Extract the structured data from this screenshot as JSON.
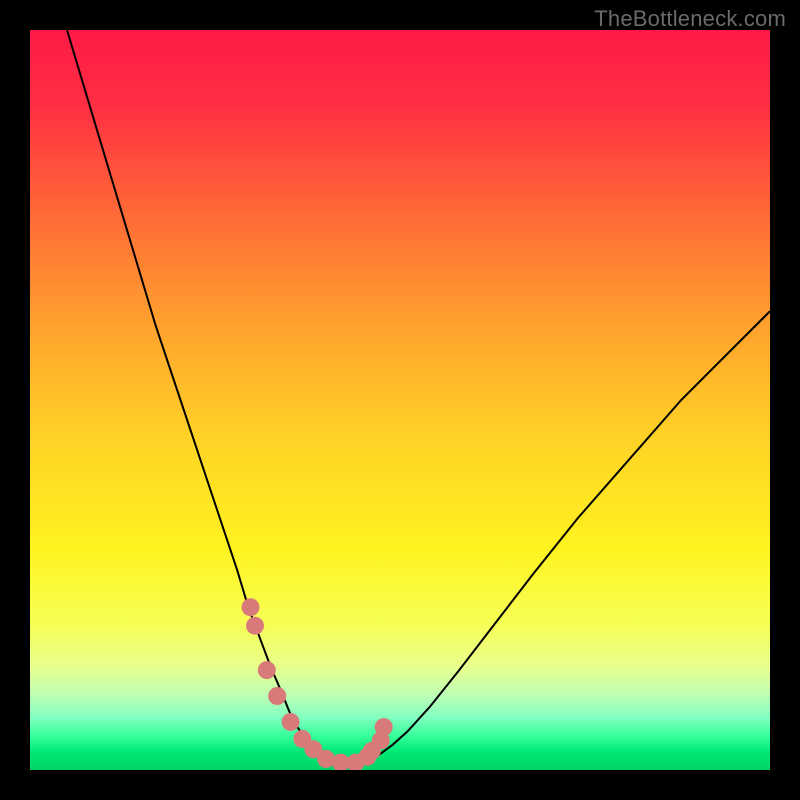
{
  "watermark": "TheBottleneck.com",
  "chart_data": {
    "type": "line",
    "title": "",
    "xlabel": "",
    "ylabel": "",
    "xlim": [
      0,
      100
    ],
    "ylim": [
      0,
      100
    ],
    "grid": false,
    "gradient_stops": [
      {
        "pos": 0.0,
        "color": "#ff1a46"
      },
      {
        "pos": 0.1,
        "color": "#ff2e43"
      },
      {
        "pos": 0.25,
        "color": "#ff6a36"
      },
      {
        "pos": 0.4,
        "color": "#ffa22e"
      },
      {
        "pos": 0.55,
        "color": "#ffd226"
      },
      {
        "pos": 0.7,
        "color": "#fff31f"
      },
      {
        "pos": 0.8,
        "color": "#f6ff54"
      },
      {
        "pos": 0.86,
        "color": "#e9ff8c"
      },
      {
        "pos": 0.9,
        "color": "#bcffb6"
      },
      {
        "pos": 0.93,
        "color": "#7effc0"
      },
      {
        "pos": 0.955,
        "color": "#33ff99"
      },
      {
        "pos": 0.975,
        "color": "#00e876"
      },
      {
        "pos": 1.0,
        "color": "#00d565"
      }
    ],
    "series": [
      {
        "name": "bottleneck-curve",
        "color": "#000000",
        "stroke_width": 2,
        "x": [
          5,
          8,
          11,
          14,
          17,
          20,
          22,
          24,
          26,
          28,
          29.5,
          31,
          32.5,
          34,
          35,
          36,
          37,
          37.8,
          38.5,
          40,
          42,
          44,
          46,
          47.5,
          49,
          51,
          54,
          58,
          63,
          68,
          74,
          81,
          88,
          95,
          100
        ],
        "y": [
          100,
          90,
          80,
          70,
          60,
          51,
          45,
          39,
          33,
          27,
          22,
          18,
          14,
          10.5,
          8,
          6,
          4.5,
          3.2,
          2.3,
          1.2,
          0.8,
          0.8,
          1.3,
          2.3,
          3.4,
          5.2,
          8.5,
          13.5,
          20,
          26.5,
          34,
          42,
          50,
          57,
          62
        ]
      },
      {
        "name": "marker-dots",
        "color": "#d97a7a",
        "type": "scatter",
        "x": [
          29.8,
          30.4,
          32.0,
          33.4,
          35.2,
          36.8,
          38.3,
          40.0,
          42.0,
          44.0,
          45.6,
          46.2,
          47.4,
          47.8
        ],
        "y": [
          22.0,
          19.5,
          13.5,
          10.0,
          6.5,
          4.2,
          2.8,
          1.5,
          1.0,
          1.0,
          1.8,
          2.6,
          4.0,
          5.8
        ],
        "r": 9
      }
    ]
  }
}
